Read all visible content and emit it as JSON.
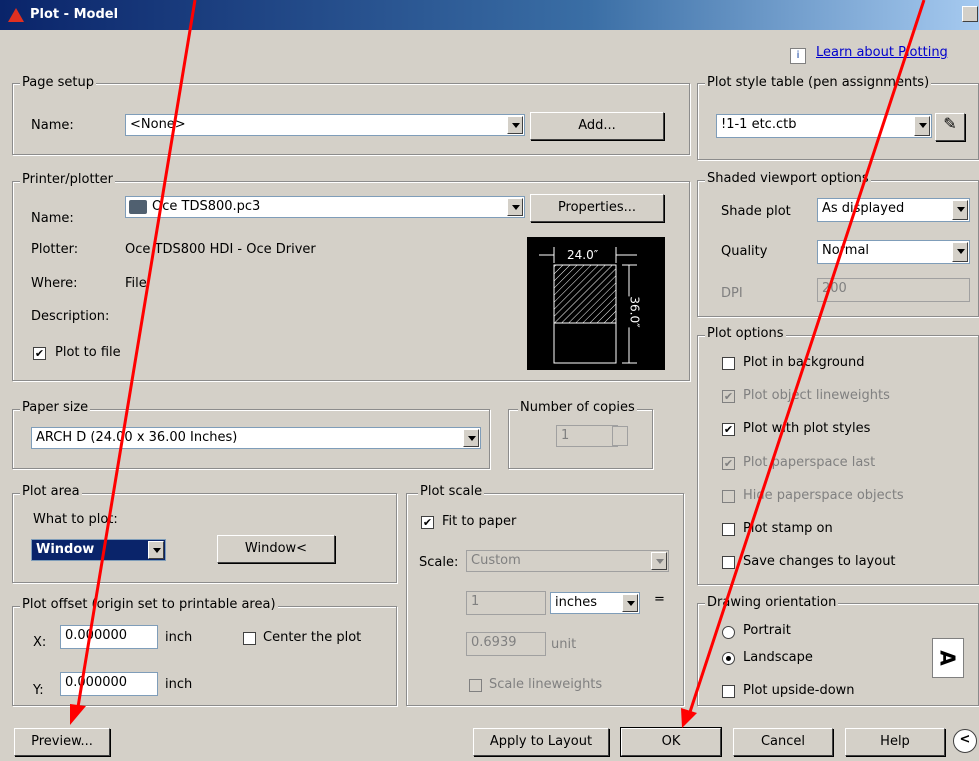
{
  "window": {
    "title": "Plot - Model"
  },
  "help_link": {
    "label": "Learn about Plotting"
  },
  "page_setup": {
    "legend": "Page setup",
    "name_label": "Name:",
    "name_value": "<None>",
    "add_button": "Add..."
  },
  "printer": {
    "legend": "Printer/plotter",
    "name_label": "Name:",
    "name_value": "Oce TDS800.pc3",
    "properties_button": "Properties...",
    "plotter_label": "Plotter:",
    "plotter_value": "Oce TDS800 HDI - Oce Driver",
    "where_label": "Where:",
    "where_value": "File",
    "description_label": "Description:",
    "plot_to_file_label": "Plot to file",
    "plot_to_file": true,
    "paper_width_label": "24.0″",
    "paper_height_label": "36.0″"
  },
  "paper_size": {
    "legend": "Paper size",
    "value": "ARCH D (24.00 x 36.00 Inches)"
  },
  "copies": {
    "legend": "Number of copies",
    "value": "1"
  },
  "plot_area": {
    "legend": "Plot area",
    "what_label": "What to plot:",
    "what_value": "Window",
    "window_button": "Window<"
  },
  "plot_scale": {
    "legend": "Plot scale",
    "fit_label": "Fit to paper",
    "fit": true,
    "scale_label": "Scale:",
    "scale_value": "Custom",
    "num_value": "1",
    "unit_value": "inches",
    "eq": "=",
    "den_value": "0.6939",
    "unit_label": "unit",
    "lineweights_label": "Scale lineweights"
  },
  "plot_offset": {
    "legend": "Plot offset (origin set to printable area)",
    "x_label": "X:",
    "x_value": "0.000000",
    "x_unit": "inch",
    "y_label": "Y:",
    "y_value": "0.000000",
    "y_unit": "inch",
    "center_label": "Center the plot"
  },
  "style_table": {
    "legend": "Plot style table (pen assignments)",
    "value": "!1-1 etc.ctb"
  },
  "shaded": {
    "legend": "Shaded viewport options",
    "shade_label": "Shade plot",
    "shade_value": "As displayed",
    "quality_label": "Quality",
    "quality_value": "Normal",
    "dpi_label": "DPI",
    "dpi_value": "200"
  },
  "plot_options": {
    "legend": "Plot options",
    "items": [
      {
        "label": "Plot in background",
        "checked": false,
        "disabled": false
      },
      {
        "label": "Plot object lineweights",
        "checked": true,
        "disabled": true
      },
      {
        "label": "Plot with plot styles",
        "checked": true,
        "disabled": false
      },
      {
        "label": "Plot paperspace last",
        "checked": true,
        "disabled": true
      },
      {
        "label": "Hide paperspace objects",
        "checked": false,
        "disabled": true
      },
      {
        "label": "Plot stamp on",
        "checked": false,
        "disabled": false
      },
      {
        "label": "Save changes to layout",
        "checked": false,
        "disabled": false
      }
    ]
  },
  "orientation": {
    "legend": "Drawing orientation",
    "portrait_label": "Portrait",
    "landscape_label": "Landscape",
    "upside_label": "Plot upside-down",
    "icon_glyph": "A"
  },
  "footer": {
    "preview_button": "Preview...",
    "apply_button": "Apply to Layout",
    "ok_button": "OK",
    "cancel_button": "Cancel",
    "help_button": "Help"
  },
  "colors": {
    "annotation_arrow": "#ff0000",
    "titlebar": "#0a246a"
  }
}
